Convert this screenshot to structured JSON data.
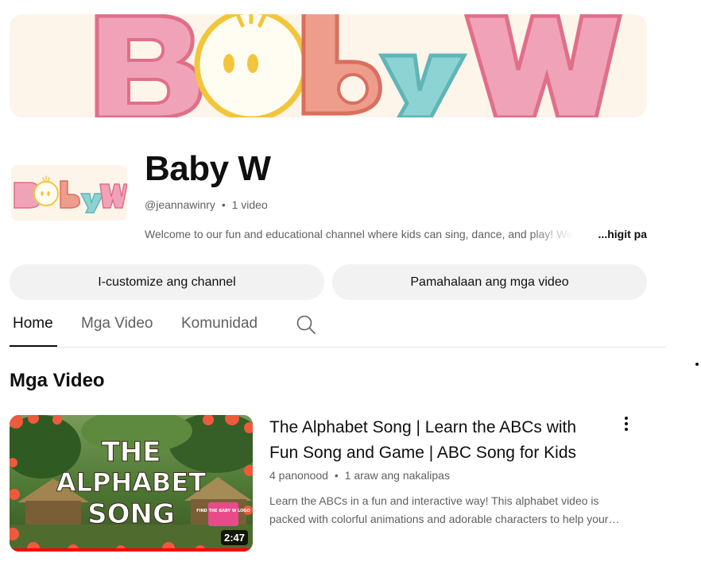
{
  "banner": {
    "logo_text": "BabyW"
  },
  "avatar": {
    "logo_text": "BabyW"
  },
  "channel": {
    "name": "Baby W",
    "handle": "@jeannawinry",
    "separator": "•",
    "video_count": "1 video",
    "description": "Welcome to our fun and educational channel where kids can sing, dance, and play! We",
    "more_label": "...higit pa"
  },
  "actions": {
    "customize_label": "I-customize ang channel",
    "manage_label": "Pamahalaan ang mga video"
  },
  "tabs": [
    {
      "label": "Home",
      "active": true
    },
    {
      "label": "Mga Video",
      "active": false
    },
    {
      "label": "Komunidad",
      "active": false
    }
  ],
  "section": {
    "title": "Mga Video"
  },
  "videos": [
    {
      "title": "The Alphabet Song | Learn the ABCs with Fun Song and Game | ABC Song for Kids",
      "views": "4 panonood",
      "separator": "•",
      "age": "1 araw ang nakalipas",
      "description_line1": "Learn the ABCs in a fun and interactive way! This alphabet video is",
      "description_line2": "packed with colorful animations and adorable characters to help your…",
      "duration": "2:47",
      "thumbnail_title_line1": "THE",
      "thumbnail_title_line2": "ALPHABET",
      "thumbnail_title_line3": "SONG",
      "thumbnail_badge": "FIND THE BABY W LOGO",
      "watch_progress": 1.0
    }
  ],
  "colors": {
    "accent_red": "#ff0000",
    "logo_pink": "#f0a3b8",
    "logo_yellow": "#f3c53a",
    "logo_salmon": "#ee9c8c",
    "logo_teal": "#8ed3d3"
  }
}
